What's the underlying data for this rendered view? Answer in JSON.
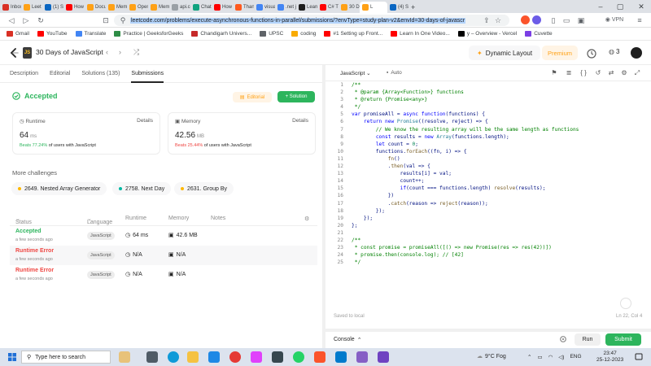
{
  "browser": {
    "tabs": [
      {
        "label": "Inbox",
        "color": "#d93025"
      },
      {
        "label": "Leet",
        "color": "#ffa116"
      },
      {
        "label": "(1) S",
        "color": "#0a66c2"
      },
      {
        "label": "How",
        "color": "#ff0000"
      },
      {
        "label": "Docu",
        "color": "#ffa116"
      },
      {
        "label": "Mem",
        "color": "#ffa116"
      },
      {
        "label": "Open",
        "color": "#ffa116"
      },
      {
        "label": "Mem",
        "color": "#ffa116"
      },
      {
        "label": "api.co",
        "color": "#9aa0a6"
      },
      {
        "label": "Chat",
        "color": "#10a37f"
      },
      {
        "label": "How",
        "color": "#ff0000"
      },
      {
        "label": "Than",
        "color": "#ff5a1f"
      },
      {
        "label": "visua",
        "color": "#4285f4"
      },
      {
        "label": ".net j",
        "color": "#4285f4"
      },
      {
        "label": "Learn",
        "color": "#1e1e1e"
      },
      {
        "label": "C# T",
        "color": "#ff0000"
      },
      {
        "label": "30 D",
        "color": "#ffa116"
      },
      {
        "label": "L",
        "color": "#ffa116",
        "active": true
      },
      {
        "label": "(4) S",
        "color": "#0a66c2"
      }
    ],
    "new_tab": "+",
    "url_host": "leetcode.com",
    "url_path": "/problems/execute-asynchronous-functions-in-parallel/submissions/?envType=study-plan-v2&envId=30-days-of-javascr",
    "vpn_label": "VPN",
    "bookmarks": [
      {
        "label": "Gmail",
        "color": "#d93025"
      },
      {
        "label": "YouTube",
        "color": "#ff0000"
      },
      {
        "label": "Translate",
        "color": "#4285f4"
      },
      {
        "label": "Practice | GeeksforGeeks",
        "color": "#2f8d46"
      },
      {
        "label": "Chandigarh Univers...",
        "color": "#c62828"
      },
      {
        "label": "UPSC",
        "color": "#5f6368"
      },
      {
        "label": "coding",
        "color": "#f9ab00"
      },
      {
        "label": "#1 Setting up Front...",
        "color": "#ff0000"
      },
      {
        "label": "Learn In One Video...",
        "color": "#ff0000"
      },
      {
        "label": "y – Overview - Vercel",
        "color": "#000000"
      },
      {
        "label": "Cuvette",
        "color": "#7b3fe4"
      }
    ]
  },
  "header": {
    "study_badge": "JS",
    "study_title": "30 Days of JavaScript",
    "dynamic_layout": "Dynamic Layout",
    "premium": "Premium",
    "streak": "3",
    "accent": "#ffa116"
  },
  "left": {
    "tabs": [
      "Description",
      "Editorial",
      "Solutions (135)",
      "Submissions"
    ],
    "status": "Accepted",
    "editorial_btn": "Editorial",
    "solution_btn": "+ Solution",
    "runtime": {
      "label": "Runtime",
      "details": "Details",
      "value": "64",
      "unit": "ms",
      "beats_pct": "Beats 77.24%",
      "beats_rest": "of users with JavaScript"
    },
    "memory": {
      "label": "Memory",
      "details": "Details",
      "value": "42.56",
      "unit": "MB",
      "beats_pct": "Beats 25.44%",
      "beats_rest": "of users with JavaScript"
    },
    "more_challenges": "More challenges",
    "challenges": [
      {
        "label": "2649. Nested Array Generator",
        "color": "#ffb800"
      },
      {
        "label": "2758. Next Day",
        "color": "#00b8a3"
      },
      {
        "label": "2631. Group By",
        "color": "#ffb800"
      }
    ],
    "table_headers": {
      "status": "Status",
      "language": "Language",
      "runtime": "Runtime",
      "memory": "Memory",
      "notes": "Notes"
    },
    "rows": [
      {
        "status": "Accepted",
        "time": "a few seconds ago",
        "lang": "JavaScript",
        "runtime": "64 ms",
        "memory": "42.6 MB",
        "color": "#2db55d"
      },
      {
        "status": "Runtime Error",
        "time": "a few seconds ago",
        "lang": "JavaScript",
        "runtime": "N/A",
        "memory": "N/A",
        "color": "#ef4743"
      },
      {
        "status": "Runtime Error",
        "time": "a few seconds ago",
        "lang": "JavaScript",
        "runtime": "N/A",
        "memory": "N/A",
        "color": "#ef4743"
      }
    ]
  },
  "editor": {
    "language": "JavaScript",
    "mode": "Auto",
    "saved": "Saved to local",
    "cursor": "Ln 22, Col 4",
    "lines": [
      "/**",
      " * @param {Array<Function>} functions",
      " * @return {Promise<any>}",
      " */",
      "var promiseAll = async function(functions) {",
      "    return new Promise((resolve, reject) => {",
      "        // We know the resulting array will be the same length as functions",
      "        const results = new Array(functions.length);",
      "        let count = 0;",
      "        functions.forEach((fn, i) => {",
      "            fn()",
      "            .then(val => {",
      "                results[i] = val;",
      "                count++;",
      "                if(count === functions.length) resolve(results);",
      "            })",
      "            .catch(reason => reject(reason));",
      "        });",
      "    });",
      "};",
      "",
      "/**",
      " * const promise = promiseAll([() => new Promise(res => res(42))])",
      " * promise.then(console.log); // [42]",
      " */"
    ]
  },
  "console": {
    "label": "Console",
    "run": "Run",
    "submit": "Submit"
  },
  "taskbar": {
    "search_placeholder": "Type here to search",
    "weather": "9°C Fog",
    "lang": "ENG",
    "time": "23:47",
    "date": "25-12-2023"
  }
}
